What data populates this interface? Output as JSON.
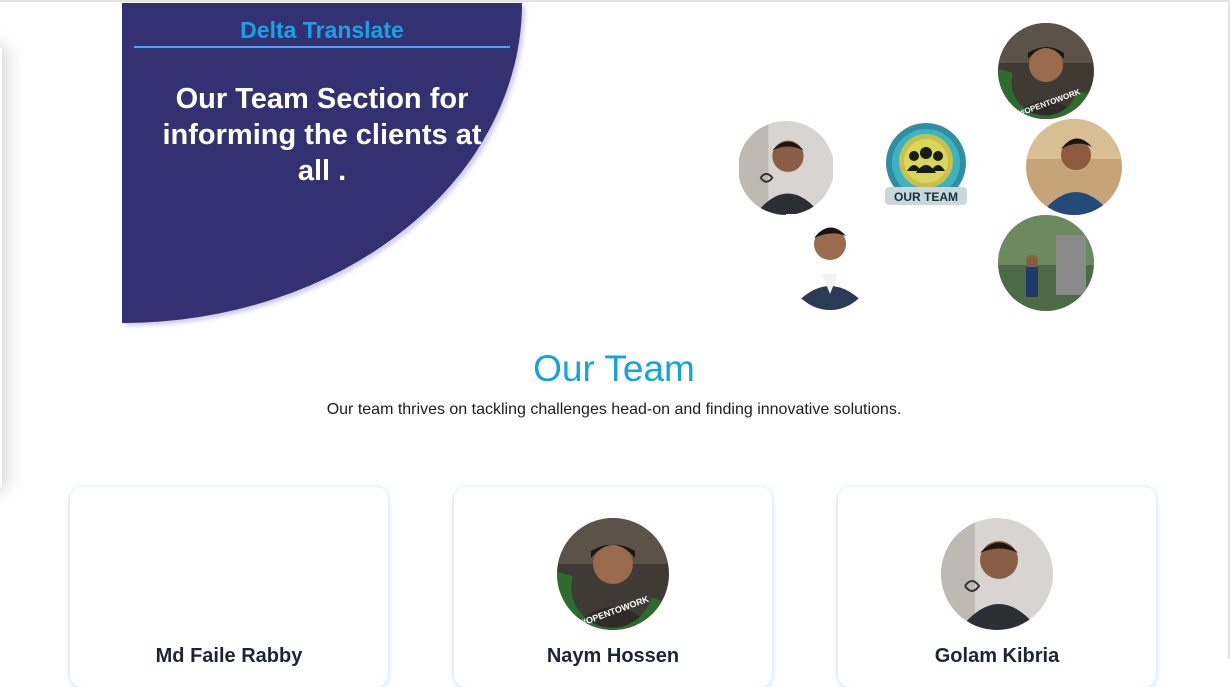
{
  "hero": {
    "brand": "Delta Translate",
    "headline": "Our Team Section for informing the clients at all ."
  },
  "collage": {
    "badge_label": "OUR TEAM",
    "frame_text": "#OPENTOWORK"
  },
  "section": {
    "title": "Our Team",
    "description": "Our team thrives on tackling challenges head-on and finding innovative solutions."
  },
  "members": [
    {
      "name": "Md Faile Rabby"
    },
    {
      "name": "Naym Hossen",
      "frame_text": "#OPENTOWORK"
    },
    {
      "name": "Golam Kibria"
    }
  ],
  "colors": {
    "hero_bg": "#343172",
    "brand": "#17a3e3",
    "title": "#13a4dc"
  }
}
